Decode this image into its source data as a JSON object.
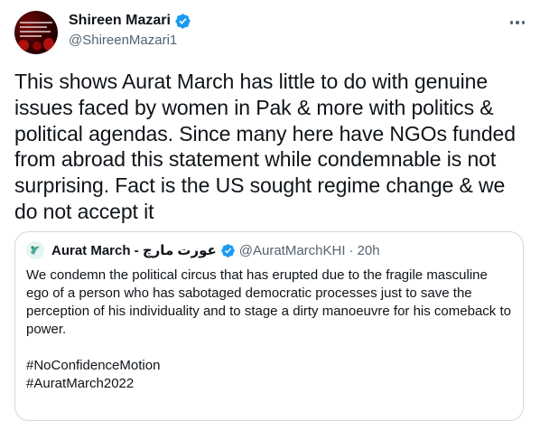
{
  "author": {
    "display_name": "Shireen Mazari",
    "handle": "@ShireenMazari1",
    "verified": true,
    "avatar_icon": "profile-photo"
  },
  "tweet": {
    "text": "This shows Aurat March has little to do with genuine issues faced by women in Pak & more with politics & political agendas. Since many here have NGOs funded from abroad this statement while condemnable is not surprising. Fact is the US sought regime change & we do not accept it"
  },
  "quoted_tweet": {
    "display_name": "Aurat March - عورت مارچ",
    "handle": "@AuratMarchKHI",
    "separator": "·",
    "time": "20h",
    "verified": true,
    "body": "We condemn the political circus that has erupted due to the fragile masculine ego of a person who has sabotaged democratic processes just to save the perception of his individuality and to stage a dirty manoeuvre for his comeback to power.",
    "hashtags": [
      "#NoConfidenceMotion",
      "#AuratMarch2022"
    ]
  },
  "colors": {
    "text_primary": "#0f1419",
    "text_secondary": "#536471",
    "verified_blue": "#1d9bf0",
    "border": "#cfd9de"
  }
}
